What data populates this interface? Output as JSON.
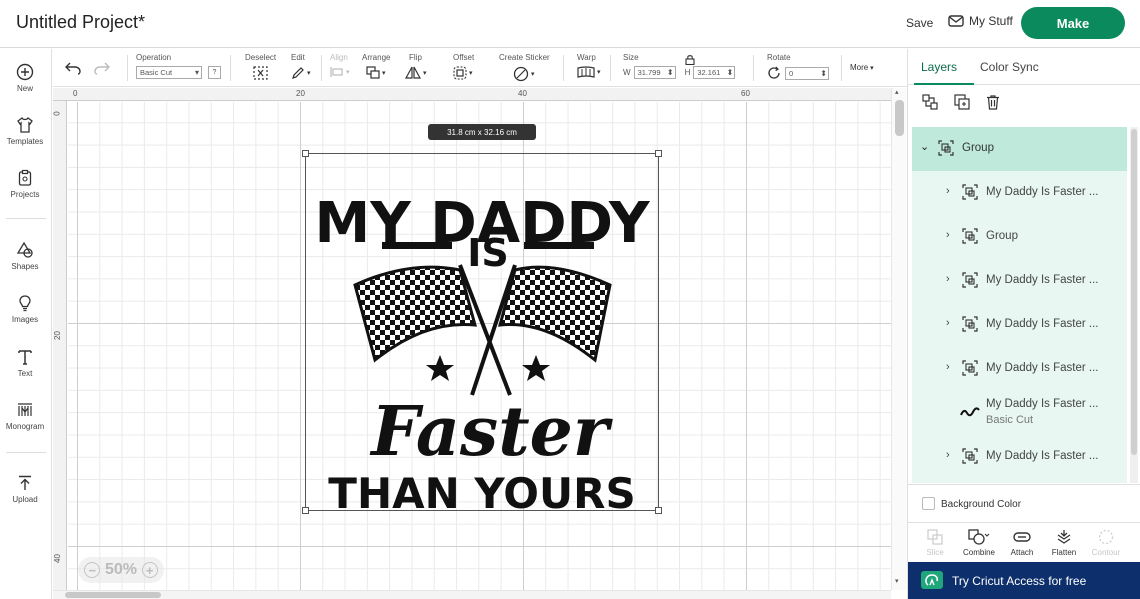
{
  "header": {
    "project_title": "Untitled Project*",
    "save_label": "Save",
    "my_stuff_label": "My Stuff",
    "make_label": "Make"
  },
  "left_nav": {
    "items": [
      {
        "label": "New",
        "icon": "plus-circle-icon"
      },
      {
        "label": "Templates",
        "icon": "shirt-icon"
      },
      {
        "label": "Projects",
        "icon": "clipboard-icon"
      },
      {
        "label": "Shapes",
        "icon": "shapes-icon"
      },
      {
        "label": "Images",
        "icon": "lightbulb-icon"
      },
      {
        "label": "Text",
        "icon": "text-icon"
      },
      {
        "label": "Monogram",
        "icon": "monogram-icon"
      },
      {
        "label": "Upload",
        "icon": "upload-icon"
      }
    ]
  },
  "toolbar": {
    "operation_label": "Operation",
    "operation_value": "Basic Cut",
    "operation_help": "?",
    "deselect_label": "Deselect",
    "edit_label": "Edit",
    "align_label": "Align",
    "arrange_label": "Arrange",
    "flip_label": "Flip",
    "offset_label": "Offset",
    "create_sticker_label": "Create Sticker",
    "warp_label": "Warp",
    "size_label": "Size",
    "width_label": "W",
    "width_value": "31.799",
    "height_label": "H",
    "height_value": "32.161",
    "rotate_label": "Rotate",
    "rotate_value": "0",
    "more_label": "More"
  },
  "canvas": {
    "ruler_top": [
      "0",
      "20",
      "40",
      "60"
    ],
    "ruler_left": [
      "0",
      "20",
      "40"
    ],
    "dimension_tag": "31.8  cm x 32.16  cm",
    "zoom_level": "50%",
    "design_text": {
      "line1": "MY DADDY",
      "line2": "IS",
      "line3": "Faster",
      "line4": "THAN YOURS"
    }
  },
  "right_panel": {
    "tabs": [
      "Layers",
      "Color Sync"
    ],
    "active_tab": "Layers",
    "layers": [
      {
        "label": "Group",
        "expanded": true
      },
      {
        "label": "My Daddy Is Faster ..."
      },
      {
        "label": "Group"
      },
      {
        "label": "My Daddy Is Faster ..."
      },
      {
        "label": "My Daddy Is Faster ..."
      },
      {
        "label": "My Daddy Is Faster ..."
      },
      {
        "label": "My Daddy Is Faster ...",
        "sub": "Basic Cut"
      },
      {
        "label": "My Daddy Is Faster ..."
      }
    ],
    "background_color_label": "Background Color",
    "bottom_tools": [
      {
        "label": "Slice",
        "enabled": false
      },
      {
        "label": "Combine",
        "enabled": true
      },
      {
        "label": "Attach",
        "enabled": true
      },
      {
        "label": "Flatten",
        "enabled": true
      },
      {
        "label": "Contour",
        "enabled": false
      }
    ],
    "access_banner": "Try Cricut Access for free"
  },
  "colors": {
    "make_button": "#0b8a5d",
    "layer_selected": "#bfeadb",
    "layer_group_bg": "#e8f7f1",
    "access_banner": "#0d2f6b"
  }
}
